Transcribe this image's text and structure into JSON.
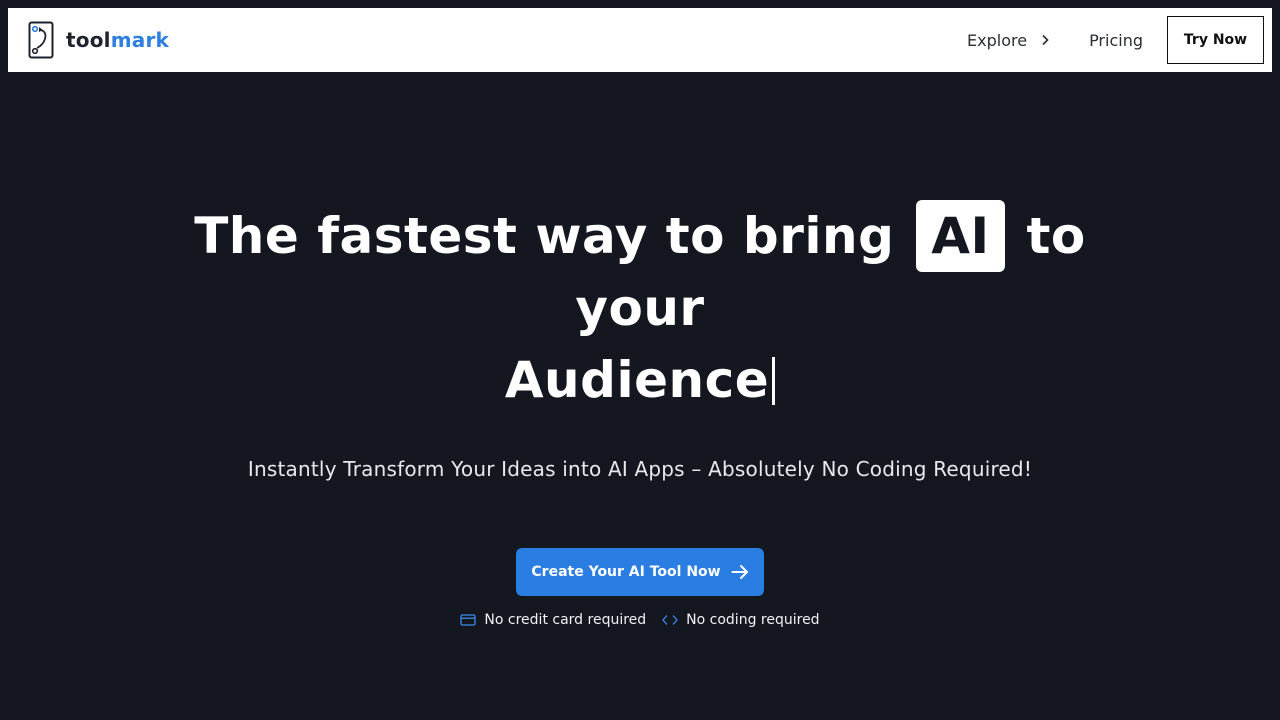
{
  "navbar": {
    "brand_part1": "tool",
    "brand_part2": "mark",
    "logo_icon": "toolmark-logo-icon",
    "links": {
      "explore": "Explore",
      "pricing": "Pricing"
    },
    "try_now": "Try Now"
  },
  "hero": {
    "title_line1": "The fastest way to bring",
    "title_chip": "AI",
    "title_line1_end": "to",
    "title_line2": "your",
    "title_line3": "Audience",
    "subtitle": "Instantly Transform Your Ideas into AI Apps – Absolutely No Coding Required!",
    "cta_label": "Create Your AI Tool Now",
    "badges": [
      {
        "icon": "credit-card-icon",
        "label": "No credit card required"
      },
      {
        "icon": "code-icon",
        "label": "No coding required"
      }
    ]
  },
  "colors": {
    "background": "#141720",
    "accent": "#2a7de1",
    "brand_accent": "#2f7fe0"
  }
}
